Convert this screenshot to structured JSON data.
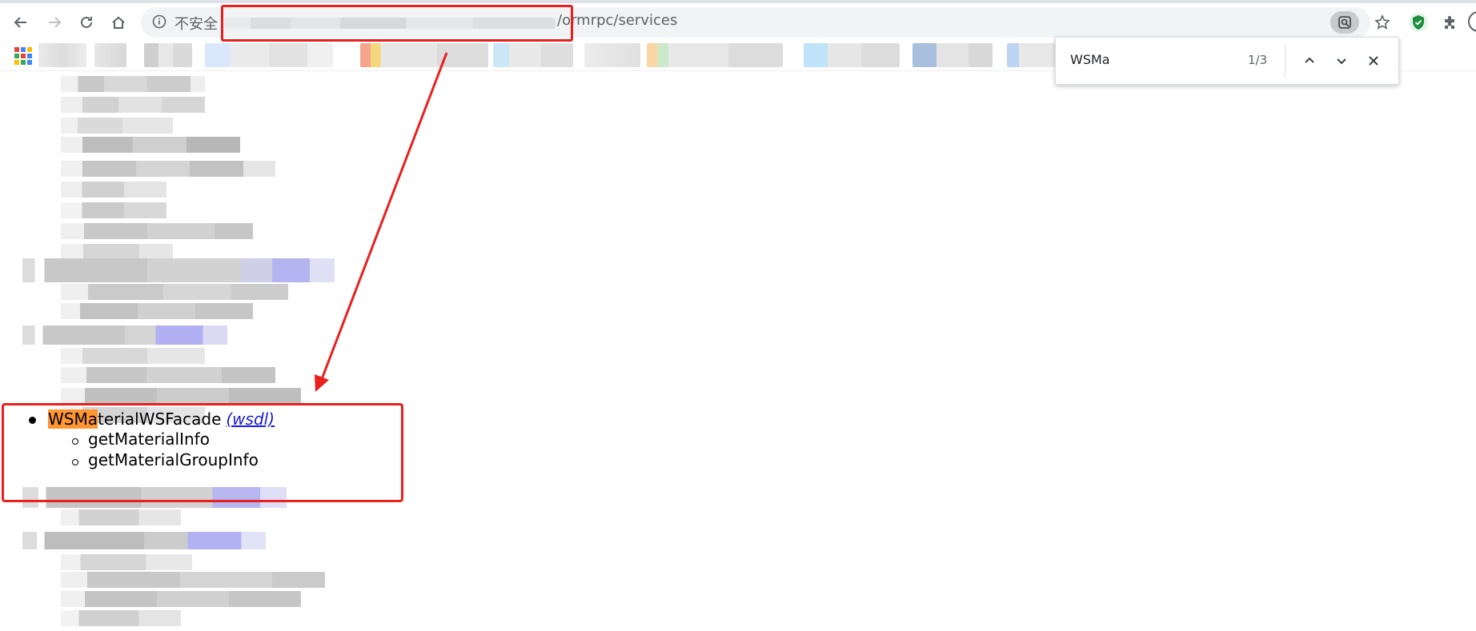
{
  "browser": {
    "security_label": "不安全",
    "url_visible": "/ormrpc/services"
  },
  "findbar": {
    "query": "WSMa",
    "count": "1/3"
  },
  "service": {
    "highlight": "WSMa",
    "name_rest": "terialWSFacade",
    "wsdl_label": "(wsdl)",
    "methods": [
      "getMaterialInfo",
      "getMaterialGroupInfo"
    ]
  },
  "colors": {
    "annotation": "#e8201e",
    "find_highlight": "#ff9632",
    "link": "#1a1ad6"
  },
  "icons": [
    "back-icon",
    "forward-icon",
    "reload-icon",
    "home-icon",
    "info-icon",
    "lens-icon",
    "star-icon",
    "shield-icon",
    "puzzle-icon",
    "apps-icon",
    "chevron-up-icon",
    "chevron-down-icon",
    "close-icon"
  ]
}
